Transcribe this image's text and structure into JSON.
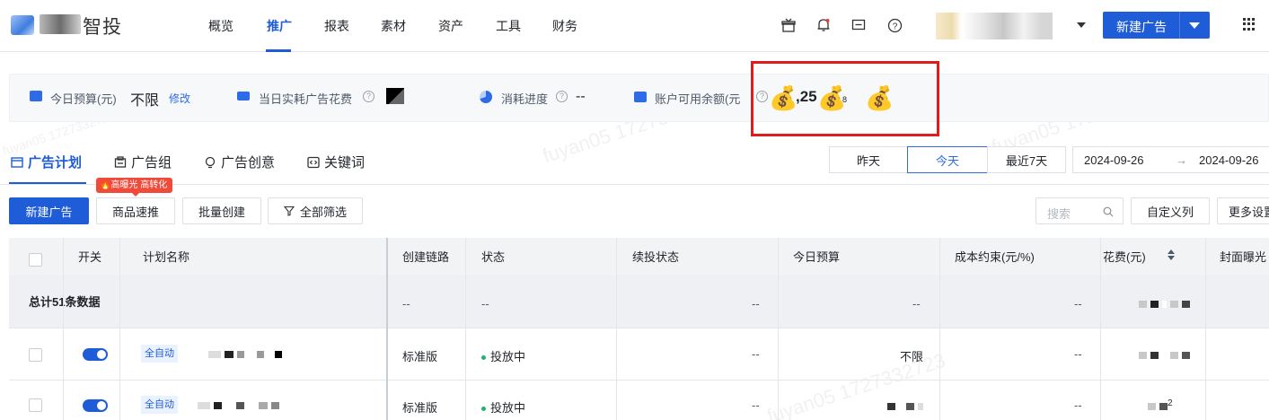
{
  "topnav": {
    "logo_text": "智投",
    "items": [
      "概览",
      "推广",
      "报表",
      "素材",
      "资产",
      "工具",
      "财务"
    ],
    "active_index": 1,
    "new_ad_button": "新建广告",
    "icons": [
      "gift-icon",
      "bell-icon",
      "message-icon",
      "help-icon"
    ],
    "accent": "#1e5cd8"
  },
  "stats": {
    "today_budget_label": "今日预算(元)",
    "today_budget_value": "不限",
    "edit_link": "修改",
    "today_spend_label": "当日实耗广告花费",
    "progress_label": "消耗进度",
    "progress_value": "--",
    "balance_label": "账户可用余额(元",
    "balance_partial": ",25",
    "balance_tail": "8"
  },
  "tabs": {
    "items": [
      "广告计划",
      "广告组",
      "广告创意",
      "关键词"
    ],
    "active_index": 0
  },
  "date_filter": {
    "buttons": [
      "昨天",
      "今天",
      "最近7天"
    ],
    "active_index": 1,
    "start": "2024-09-26",
    "arrow": "→",
    "end": "2024-09-26"
  },
  "actions": {
    "new_ad": "新建广告",
    "quick_promote": "商品速推",
    "hot_badge": "高曝光 高转化",
    "batch_create": "批量创建",
    "filter_all": "全部筛选",
    "search_placeholder": "搜索",
    "custom_columns": "自定义列",
    "more_settings": "更多设置"
  },
  "table": {
    "headers": [
      "开关",
      "计划名称",
      "创建链路",
      "状态",
      "续投状态",
      "今日预算",
      "成本约束(元/%)",
      "花费(元)",
      "封面曝光"
    ],
    "summary_label": "总计51条数据",
    "summary_dash": "--",
    "rows": [
      {
        "name_tag": "全自动",
        "chain": "标准版",
        "status": "投放中",
        "renew": "--",
        "budget": "不限",
        "cost": "--"
      },
      {
        "name_tag": "全自动",
        "chain": "标准版",
        "status": "投放中",
        "renew": "--",
        "budget": "",
        "cost": "--",
        "spend_tail": "2"
      }
    ]
  },
  "watermark": "fuyan05 1727332723"
}
